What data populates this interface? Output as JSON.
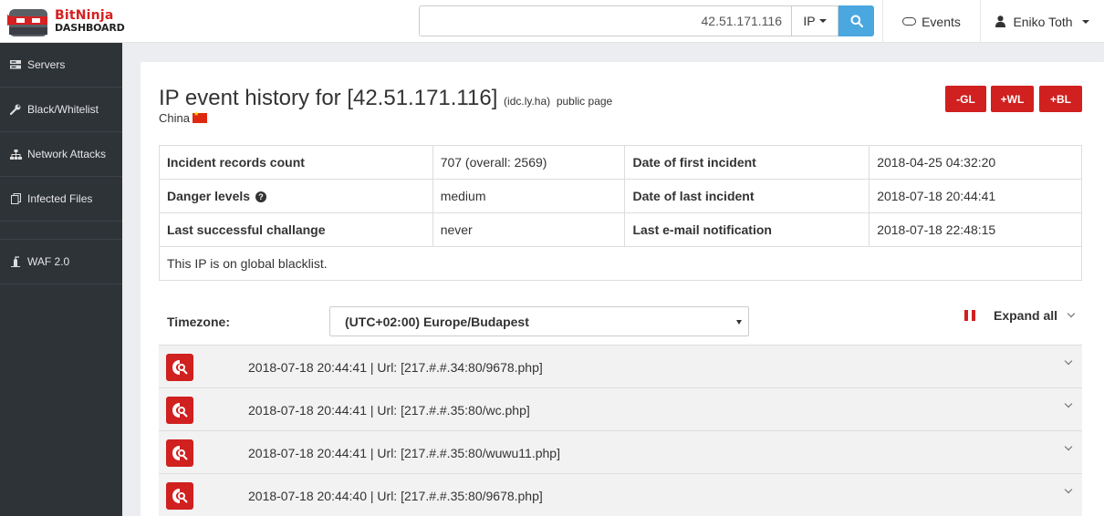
{
  "brand": {
    "name_part1": "Bit",
    "name_part2": "Ninja",
    "subtitle": "DASHBOARD"
  },
  "search": {
    "value": "42.51.171.116",
    "type_label": "IP"
  },
  "nav": {
    "events_label": "Events",
    "user_name": "Eniko Toth"
  },
  "sidebar": {
    "items": [
      {
        "label": "Servers",
        "icon": "server-icon"
      },
      {
        "label": "Black/Whitelist",
        "icon": "wrench-icon"
      },
      {
        "label": "Network Attacks",
        "icon": "sitemap-icon"
      },
      {
        "label": "Infected Files",
        "icon": "files-icon"
      },
      {
        "label": "WAF 2.0",
        "icon": "fire-extinguisher-icon"
      }
    ]
  },
  "page": {
    "title": "IP event history for [42.51.171.116]",
    "host": "(idc.ly.ha)",
    "public_link": "public page",
    "country": "China"
  },
  "actions": {
    "gl": "-GL",
    "wl": "+WL",
    "bl": "+BL"
  },
  "info": {
    "incident_count_label": "Incident records count",
    "incident_count_value": "707 (overall: 2569)",
    "first_incident_label": "Date of first incident",
    "first_incident_value": "2018-04-25 04:32:20",
    "danger_label": "Danger levels",
    "danger_value": "medium",
    "last_incident_label": "Date of last incident",
    "last_incident_value": "2018-07-18 20:44:41",
    "challenge_label": "Last successful challange",
    "challenge_value": "never",
    "email_label": "Last e-mail notification",
    "email_value": "2018-07-18 22:48:15",
    "blacklist_note": "This IP is on global blacklist."
  },
  "timezone": {
    "label": "Timezone:",
    "value": "(UTC+02:00) Europe/Budapest"
  },
  "expand_all": "Expand all",
  "events": [
    {
      "text": "2018-07-18 20:44:41 | Url: [217.#.#.34:80/9678.php]"
    },
    {
      "text": "2018-07-18 20:44:41 | Url: [217.#.#.35:80/wc.php]"
    },
    {
      "text": "2018-07-18 20:44:41 | Url: [217.#.#.35:80/wuwu11.php]"
    },
    {
      "text": "2018-07-18 20:44:40 | Url: [217.#.#.35:80/9678.php]"
    }
  ],
  "colors": {
    "accent_red": "#d0201f",
    "sidebar_bg": "#2e3338",
    "search_blue": "#4aa7e0"
  }
}
